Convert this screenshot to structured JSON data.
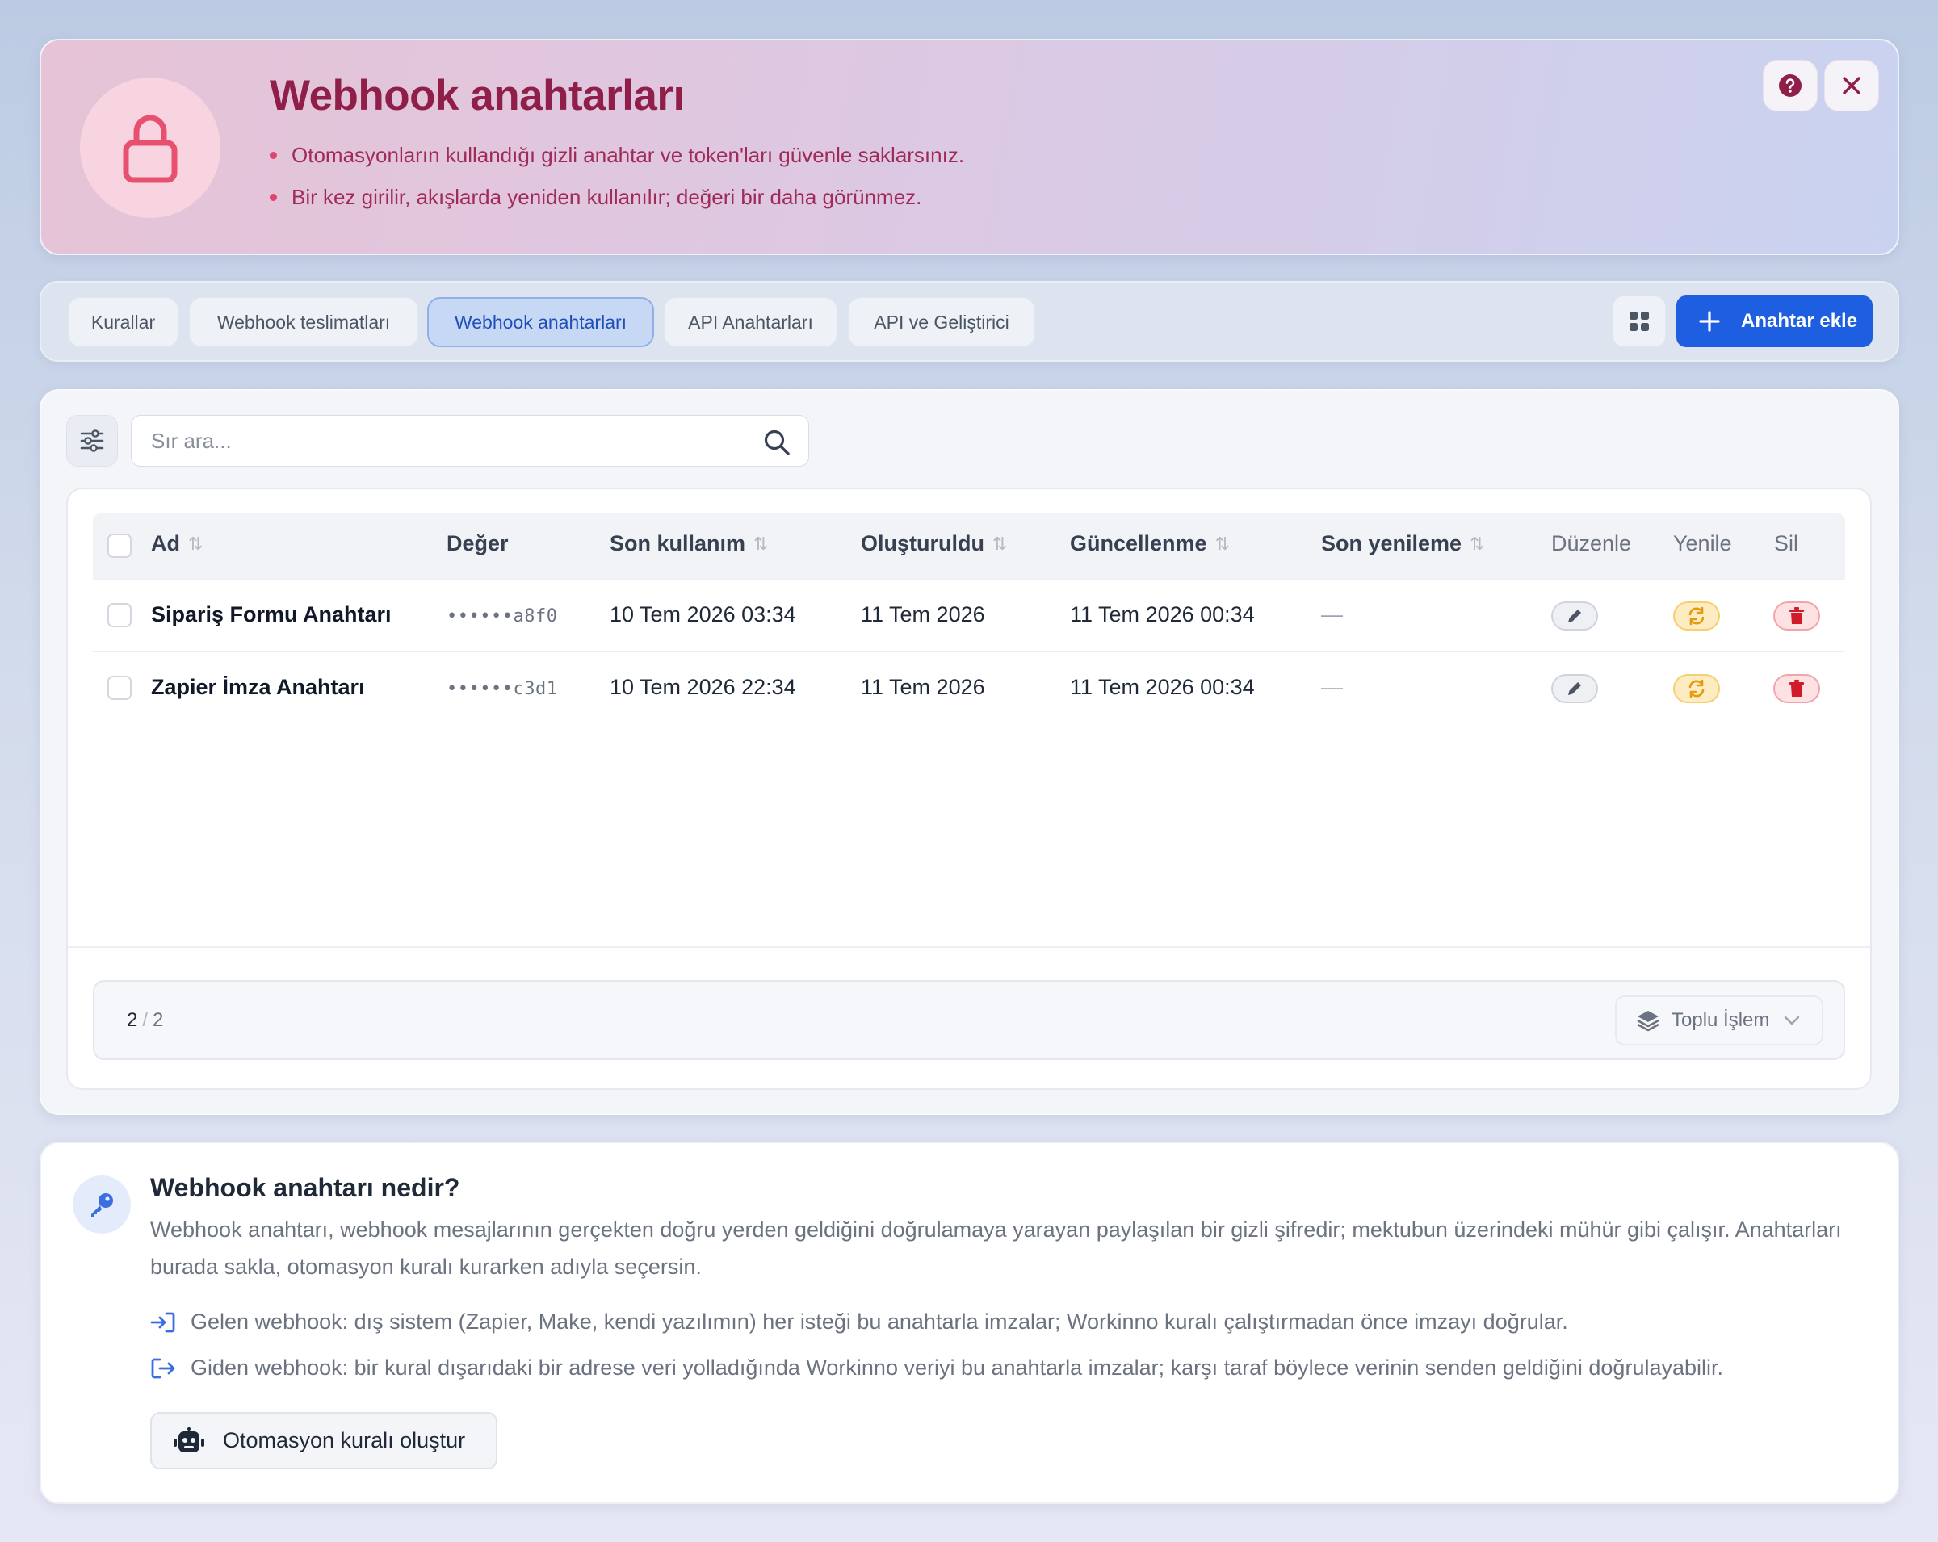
{
  "header": {
    "title": "Webhook anahtarları",
    "bullets": [
      "Otomasyonların kullandığı gizli anahtar ve token'ları güvenle saklarsınız.",
      "Bir kez girilir, akışlarda yeniden kullanılır; değeri bir daha görünmez."
    ],
    "icons": {
      "main": "lock-icon",
      "help": "help-icon",
      "close": "close-icon"
    },
    "accent_color": "#8f1f48"
  },
  "tabs": [
    {
      "label": "Kurallar",
      "active": false
    },
    {
      "label": "Webhook teslimatları",
      "active": false
    },
    {
      "label": "Webhook anahtarları",
      "active": true
    },
    {
      "label": "API Anahtarları",
      "active": false
    },
    {
      "label": "API ve Geliştirici",
      "active": false
    }
  ],
  "toolbar": {
    "add_label": "Anahtar ekle",
    "add_color": "#1d5fe0"
  },
  "search": {
    "placeholder": "Sır ara...",
    "value": ""
  },
  "table": {
    "columns": [
      "Ad",
      "Değer",
      "Son kullanım",
      "Oluşturuldu",
      "Güncellenme",
      "Son yenileme",
      "Düzenle",
      "Yenile",
      "Sil"
    ],
    "sort_glyph": "⇅",
    "rows": [
      {
        "name": "Sipariş Formu Anahtarı",
        "value": "••••••a8f0",
        "last_used": "10 Tem 2026 03:34",
        "created": "11 Tem 2026",
        "updated": "11 Tem 2026 00:34",
        "last_renewed": "—"
      },
      {
        "name": "Zapier İmza Anahtarı",
        "value": "••••••c3d1",
        "last_used": "10 Tem 2026 22:34",
        "created": "11 Tem 2026",
        "updated": "11 Tem 2026 00:34",
        "last_renewed": "—"
      }
    ]
  },
  "footer": {
    "shown": "2",
    "separator": "/",
    "total": "2",
    "bulk_label": "Toplu İşlem"
  },
  "info": {
    "title": "Webhook anahtarı nedir?",
    "description": "Webhook anahtarı, webhook mesajlarının gerçekten doğru yerden geldiğini doğrulamaya yarayan paylaşılan bir gizli şifredir; mektubun üzerindeki mühür gibi çalışır. Anahtarları burada sakla, otomasyon kuralı kurarken adıyla seçersin.",
    "points": [
      "Gelen webhook: dış sistem (Zapier, Make, kendi yazılımın) her isteği bu anahtarla imzalar; Workinno kuralı çalıştırmadan önce imzayı doğrular.",
      "Giden webhook: bir kural dışarıdaki bir adrese veri yolladığında Workinno veriyi bu anahtarla imzalar; karşı taraf böylece verinin senden geldiğini doğrulayabilir."
    ],
    "button_label": "Otomasyon kuralı oluştur"
  }
}
